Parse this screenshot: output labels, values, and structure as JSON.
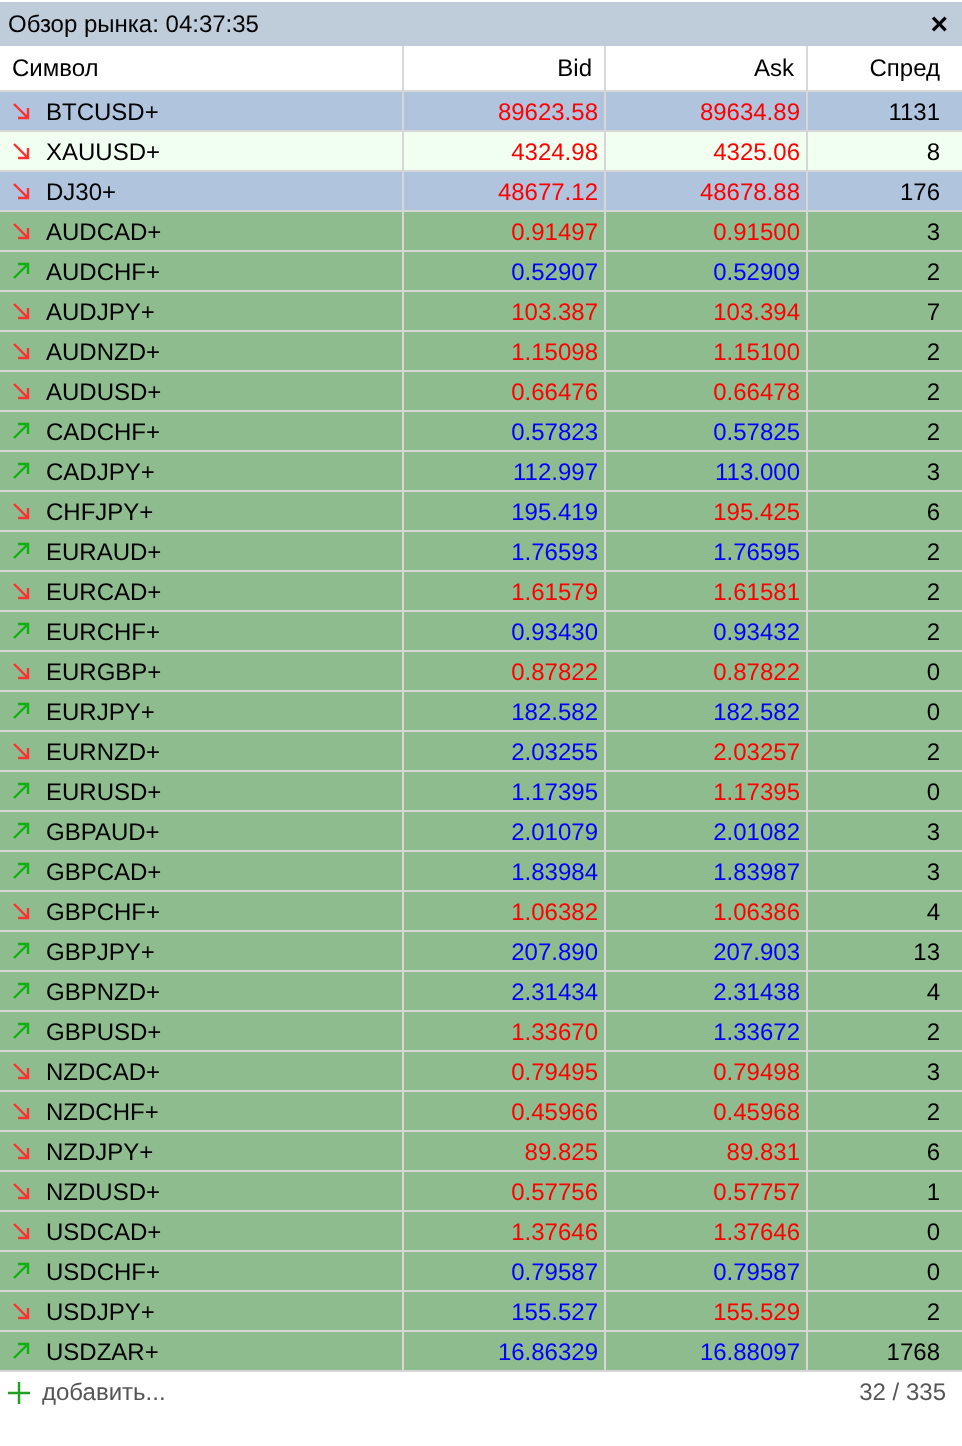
{
  "window": {
    "title": "Обзор рынка: 04:37:35",
    "close": "×"
  },
  "table": {
    "columns": [
      "Символ",
      "Bid",
      "Ask",
      "Спред"
    ],
    "rows": [
      {
        "symbol": "BTCUSD+",
        "rising": false,
        "bid": "89623.58",
        "bid_up": false,
        "ask": "89634.89",
        "ask_up": false,
        "spread": "1131",
        "color": "#b0c4de"
      },
      {
        "symbol": "XAUUSD+",
        "rising": false,
        "bid": "4324.98",
        "bid_up": false,
        "ask": "4325.06",
        "ask_up": false,
        "spread": "8",
        "color": "#f0fff0"
      },
      {
        "symbol": "DJ30+",
        "rising": false,
        "bid": "48677.12",
        "bid_up": false,
        "ask": "48678.88",
        "ask_up": false,
        "spread": "176",
        "color": "#b0c4de"
      },
      {
        "symbol": "AUDCAD+",
        "rising": false,
        "bid": "0.91497",
        "bid_up": false,
        "ask": "0.91500",
        "ask_up": false,
        "spread": "3",
        "color": "#8fbc8f"
      },
      {
        "symbol": "AUDCHF+",
        "rising": true,
        "bid": "0.52907",
        "bid_up": true,
        "ask": "0.52909",
        "ask_up": true,
        "spread": "2",
        "color": "#8fbc8f"
      },
      {
        "symbol": "AUDJPY+",
        "rising": false,
        "bid": "103.387",
        "bid_up": false,
        "ask": "103.394",
        "ask_up": false,
        "spread": "7",
        "color": "#8fbc8f"
      },
      {
        "symbol": "AUDNZD+",
        "rising": false,
        "bid": "1.15098",
        "bid_up": false,
        "ask": "1.15100",
        "ask_up": false,
        "spread": "2",
        "color": "#8fbc8f"
      },
      {
        "symbol": "AUDUSD+",
        "rising": false,
        "bid": "0.66476",
        "bid_up": false,
        "ask": "0.66478",
        "ask_up": false,
        "spread": "2",
        "color": "#8fbc8f"
      },
      {
        "symbol": "CADCHF+",
        "rising": true,
        "bid": "0.57823",
        "bid_up": true,
        "ask": "0.57825",
        "ask_up": true,
        "spread": "2",
        "color": "#8fbc8f"
      },
      {
        "symbol": "CADJPY+",
        "rising": true,
        "bid": "112.997",
        "bid_up": true,
        "ask": "113.000",
        "ask_up": true,
        "spread": "3",
        "color": "#8fbc8f"
      },
      {
        "symbol": "CHFJPY+",
        "rising": false,
        "bid": "195.419",
        "bid_up": true,
        "ask": "195.425",
        "ask_up": false,
        "spread": "6",
        "color": "#8fbc8f"
      },
      {
        "symbol": "EURAUD+",
        "rising": true,
        "bid": "1.76593",
        "bid_up": true,
        "ask": "1.76595",
        "ask_up": true,
        "spread": "2",
        "color": "#8fbc8f"
      },
      {
        "symbol": "EURCAD+",
        "rising": false,
        "bid": "1.61579",
        "bid_up": false,
        "ask": "1.61581",
        "ask_up": false,
        "spread": "2",
        "color": "#8fbc8f"
      },
      {
        "symbol": "EURCHF+",
        "rising": true,
        "bid": "0.93430",
        "bid_up": true,
        "ask": "0.93432",
        "ask_up": true,
        "spread": "2",
        "color": "#8fbc8f"
      },
      {
        "symbol": "EURGBP+",
        "rising": false,
        "bid": "0.87822",
        "bid_up": false,
        "ask": "0.87822",
        "ask_up": false,
        "spread": "0",
        "color": "#8fbc8f"
      },
      {
        "symbol": "EURJPY+",
        "rising": true,
        "bid": "182.582",
        "bid_up": true,
        "ask": "182.582",
        "ask_up": true,
        "spread": "0",
        "color": "#8fbc8f"
      },
      {
        "symbol": "EURNZD+",
        "rising": false,
        "bid": "2.03255",
        "bid_up": true,
        "ask": "2.03257",
        "ask_up": false,
        "spread": "2",
        "color": "#8fbc8f"
      },
      {
        "symbol": "EURUSD+",
        "rising": true,
        "bid": "1.17395",
        "bid_up": true,
        "ask": "1.17395",
        "ask_up": false,
        "spread": "0",
        "color": "#8fbc8f"
      },
      {
        "symbol": "GBPAUD+",
        "rising": true,
        "bid": "2.01079",
        "bid_up": true,
        "ask": "2.01082",
        "ask_up": true,
        "spread": "3",
        "color": "#8fbc8f"
      },
      {
        "symbol": "GBPCAD+",
        "rising": true,
        "bid": "1.83984",
        "bid_up": true,
        "ask": "1.83987",
        "ask_up": true,
        "spread": "3",
        "color": "#8fbc8f"
      },
      {
        "symbol": "GBPCHF+",
        "rising": false,
        "bid": "1.06382",
        "bid_up": false,
        "ask": "1.06386",
        "ask_up": false,
        "spread": "4",
        "color": "#8fbc8f"
      },
      {
        "symbol": "GBPJPY+",
        "rising": true,
        "bid": "207.890",
        "bid_up": true,
        "ask": "207.903",
        "ask_up": true,
        "spread": "13",
        "color": "#8fbc8f"
      },
      {
        "symbol": "GBPNZD+",
        "rising": true,
        "bid": "2.31434",
        "bid_up": true,
        "ask": "2.31438",
        "ask_up": true,
        "spread": "4",
        "color": "#8fbc8f"
      },
      {
        "symbol": "GBPUSD+",
        "rising": true,
        "bid": "1.33670",
        "bid_up": false,
        "ask": "1.33672",
        "ask_up": true,
        "spread": "2",
        "color": "#8fbc8f"
      },
      {
        "symbol": "NZDCAD+",
        "rising": false,
        "bid": "0.79495",
        "bid_up": false,
        "ask": "0.79498",
        "ask_up": false,
        "spread": "3",
        "color": "#8fbc8f"
      },
      {
        "symbol": "NZDCHF+",
        "rising": false,
        "bid": "0.45966",
        "bid_up": false,
        "ask": "0.45968",
        "ask_up": false,
        "spread": "2",
        "color": "#8fbc8f"
      },
      {
        "symbol": "NZDJPY+",
        "rising": false,
        "bid": "89.825",
        "bid_up": false,
        "ask": "89.831",
        "ask_up": false,
        "spread": "6",
        "color": "#8fbc8f"
      },
      {
        "symbol": "NZDUSD+",
        "rising": false,
        "bid": "0.57756",
        "bid_up": false,
        "ask": "0.57757",
        "ask_up": false,
        "spread": "1",
        "color": "#8fbc8f"
      },
      {
        "symbol": "USDCAD+",
        "rising": false,
        "bid": "1.37646",
        "bid_up": false,
        "ask": "1.37646",
        "ask_up": false,
        "spread": "0",
        "color": "#8fbc8f"
      },
      {
        "symbol": "USDCHF+",
        "rising": true,
        "bid": "0.79587",
        "bid_up": true,
        "ask": "0.79587",
        "ask_up": true,
        "spread": "0",
        "color": "#8fbc8f"
      },
      {
        "symbol": "USDJPY+",
        "rising": false,
        "bid": "155.527",
        "bid_up": true,
        "ask": "155.529",
        "ask_up": false,
        "spread": "2",
        "color": "#8fbc8f"
      },
      {
        "symbol": "USDZAR+",
        "rising": true,
        "bid": "16.86329",
        "bid_up": true,
        "ask": "16.88097",
        "ask_up": true,
        "spread": "1768",
        "color": "#8fbc8f"
      }
    ]
  },
  "footer": {
    "add_label": "добавить...",
    "count": "32 / 335"
  }
}
